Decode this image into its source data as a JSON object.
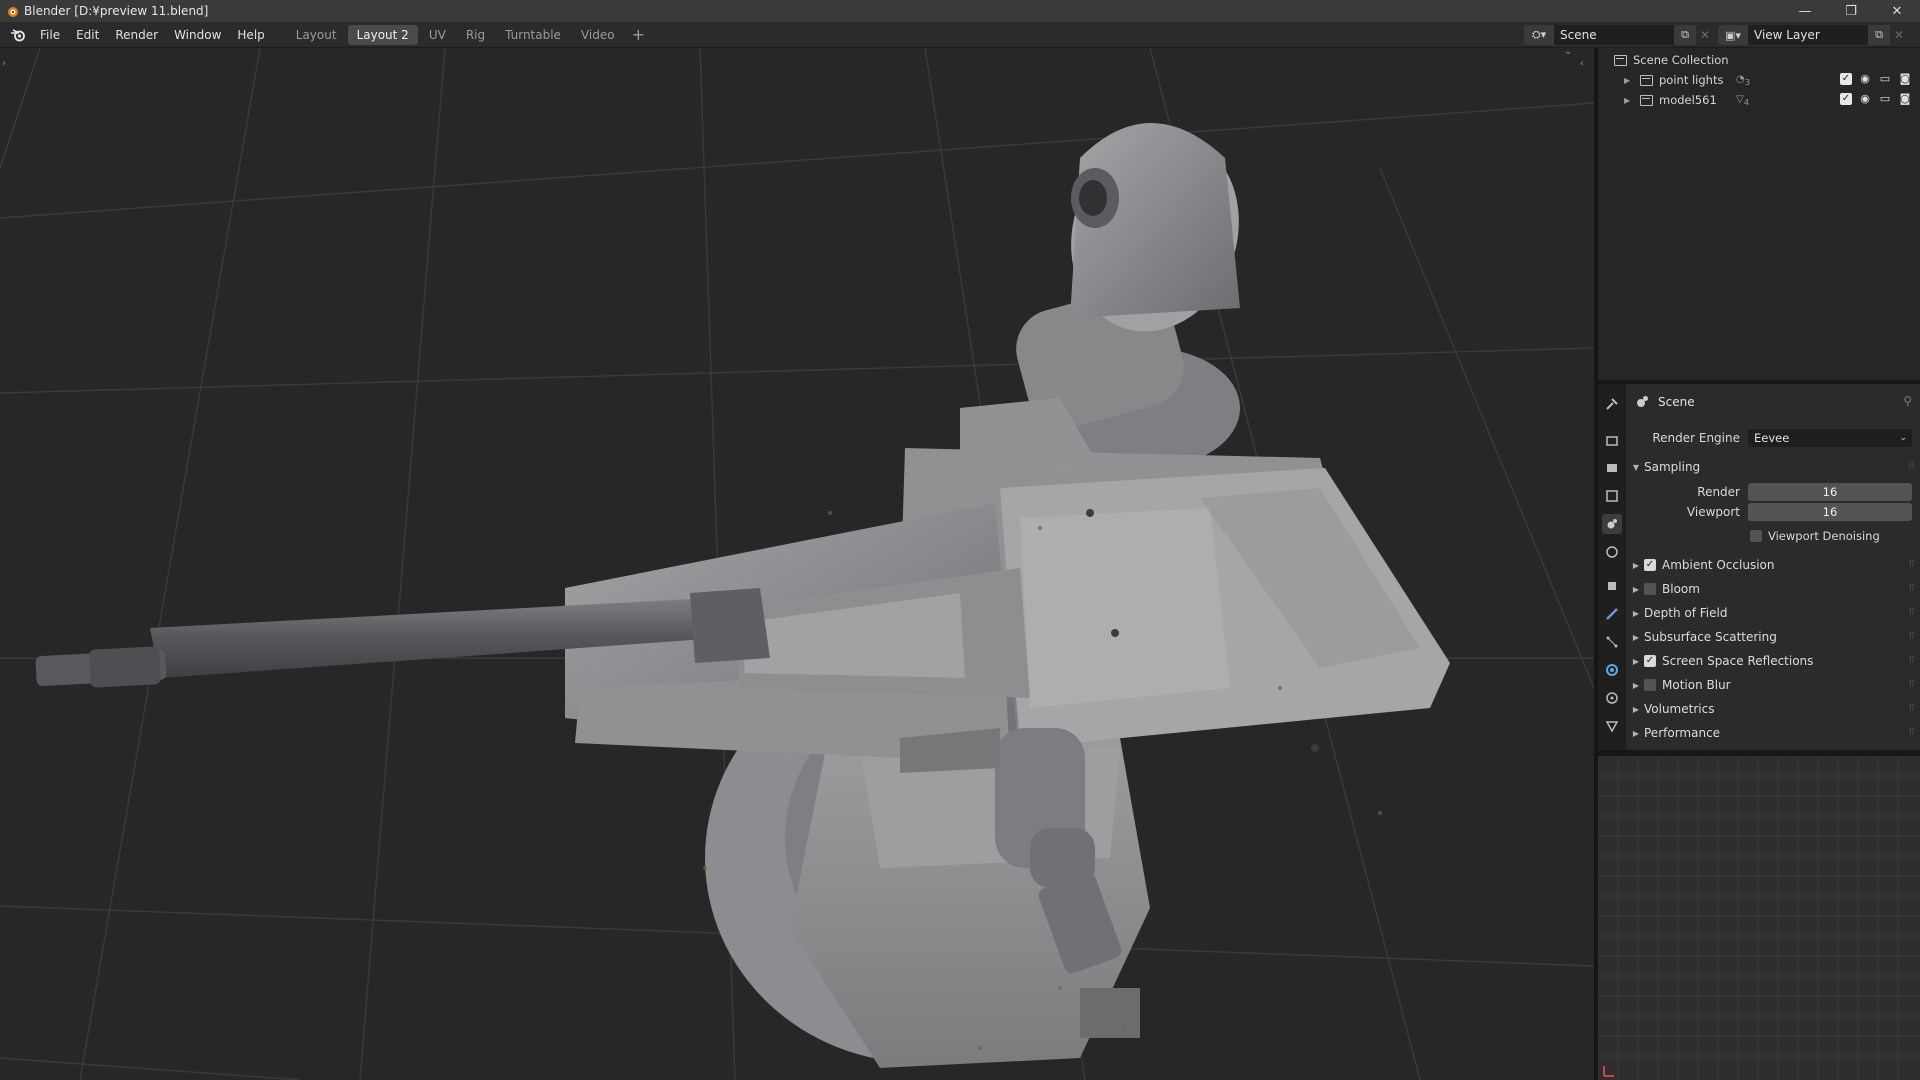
{
  "window": {
    "title": "Blender [D:¥preview 11.blend]",
    "controls": [
      "—",
      "❐",
      "✕"
    ]
  },
  "menu": [
    "File",
    "Edit",
    "Render",
    "Window",
    "Help"
  ],
  "workspaces": {
    "tabs": [
      "Layout",
      "Layout 2",
      "UV",
      "Rig",
      "Turntable",
      "Video"
    ],
    "active": "Layout 2",
    "add": "+"
  },
  "scene_selector": {
    "value": "Scene",
    "view_layer": "View Layer"
  },
  "outliner": {
    "root": "Scene Collection",
    "items": [
      {
        "name": "point lights",
        "badge": "3"
      },
      {
        "name": "model561",
        "badge": "4"
      }
    ]
  },
  "properties": {
    "header": "Scene",
    "render_engine_label": "Render Engine",
    "render_engine_value": "Eevee",
    "sampling": {
      "title": "Sampling",
      "render_label": "Render",
      "render_value": "16",
      "viewport_label": "Viewport",
      "viewport_value": "16",
      "denoise_label": "Viewport Denoising"
    },
    "panels": [
      {
        "label": "Ambient Occlusion",
        "checkbox": true,
        "checked": true
      },
      {
        "label": "Bloom",
        "checkbox": true,
        "checked": false
      },
      {
        "label": "Depth of Field",
        "checkbox": false,
        "checked": false
      },
      {
        "label": "Subsurface Scattering",
        "checkbox": false,
        "checked": false
      },
      {
        "label": "Screen Space Reflections",
        "checkbox": true,
        "checked": true
      },
      {
        "label": "Motion Blur",
        "checkbox": true,
        "checked": false
      },
      {
        "label": "Volumetrics",
        "checkbox": false,
        "checked": false
      },
      {
        "label": "Performance",
        "checkbox": false,
        "checked": false
      }
    ]
  },
  "colors": {
    "accent": "#4772b3",
    "viewport_bg": "#272727",
    "model": "#8e9092"
  }
}
